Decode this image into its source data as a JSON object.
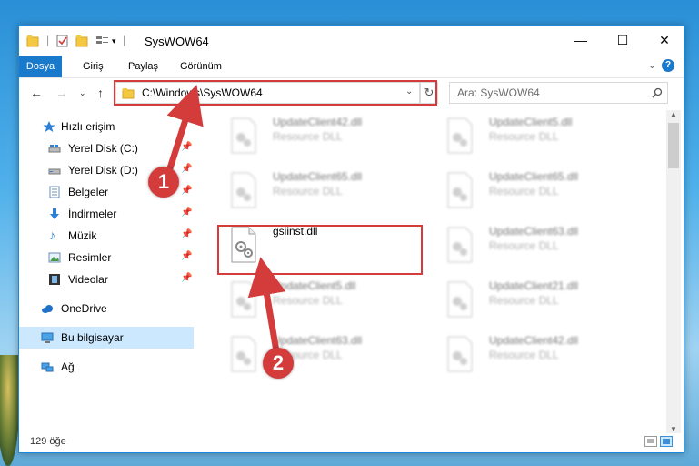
{
  "window": {
    "title": "SysWOW64",
    "controls": {
      "minimize": "—",
      "maximize": "☐",
      "close": "✕"
    }
  },
  "ribbon": {
    "tabs": [
      "Dosya",
      "Giriş",
      "Paylaş",
      "Görünüm"
    ],
    "help": "?"
  },
  "nav": {
    "address": "C:\\Windows\\SysWOW64",
    "search_placeholder": "Ara: SysWOW64"
  },
  "sidebar": {
    "items": [
      {
        "label": "Hızlı erişim",
        "icon": "star-icon"
      },
      {
        "label": "Yerel Disk (C:)",
        "icon": "drive-icon",
        "pinned": true
      },
      {
        "label": "Yerel Disk (D:)",
        "icon": "drive-icon",
        "pinned": true
      },
      {
        "label": "Belgeler",
        "icon": "documents-icon",
        "pinned": true
      },
      {
        "label": "İndirmeler",
        "icon": "downloads-icon",
        "pinned": true
      },
      {
        "label": "Müzik",
        "icon": "music-icon",
        "pinned": true
      },
      {
        "label": "Resimler",
        "icon": "pictures-icon",
        "pinned": true
      },
      {
        "label": "Videolar",
        "icon": "videos-icon",
        "pinned": true
      },
      {
        "label": "OneDrive",
        "icon": "cloud-icon"
      },
      {
        "label": "Bu bilgisayar",
        "icon": "computer-icon",
        "selected": true
      },
      {
        "label": "Ağ",
        "icon": "network-icon"
      }
    ]
  },
  "files": [
    {
      "name": "UpdateClient42.dll",
      "type": "Resource DLL"
    },
    {
      "name": "UpdateClient5.dll",
      "type": "Resource DLL"
    },
    {
      "name": "UpdateClient65.dll",
      "type": "Resource DLL"
    },
    {
      "name": "UpdateClient65.dll",
      "type": "Resource DLL"
    },
    {
      "name": "gsiinst.dll",
      "type": ""
    },
    {
      "name": "UpdateClient63.dll",
      "type": "Resource DLL"
    },
    {
      "name": "UpdateClient5.dll",
      "type": "Resource DLL"
    },
    {
      "name": "UpdateClient21.dll",
      "type": "Resource DLL"
    },
    {
      "name": "UpdateClient63.dll",
      "type": "Resource DLL"
    },
    {
      "name": "UpdateClient42.dll",
      "type": "Resource DLL"
    }
  ],
  "status": {
    "count": "129 öğe"
  },
  "annotations": [
    "1",
    "2"
  ],
  "colors": {
    "accent": "#1979ca",
    "highlight": "#d43c3c",
    "selected": "#cce8ff"
  }
}
